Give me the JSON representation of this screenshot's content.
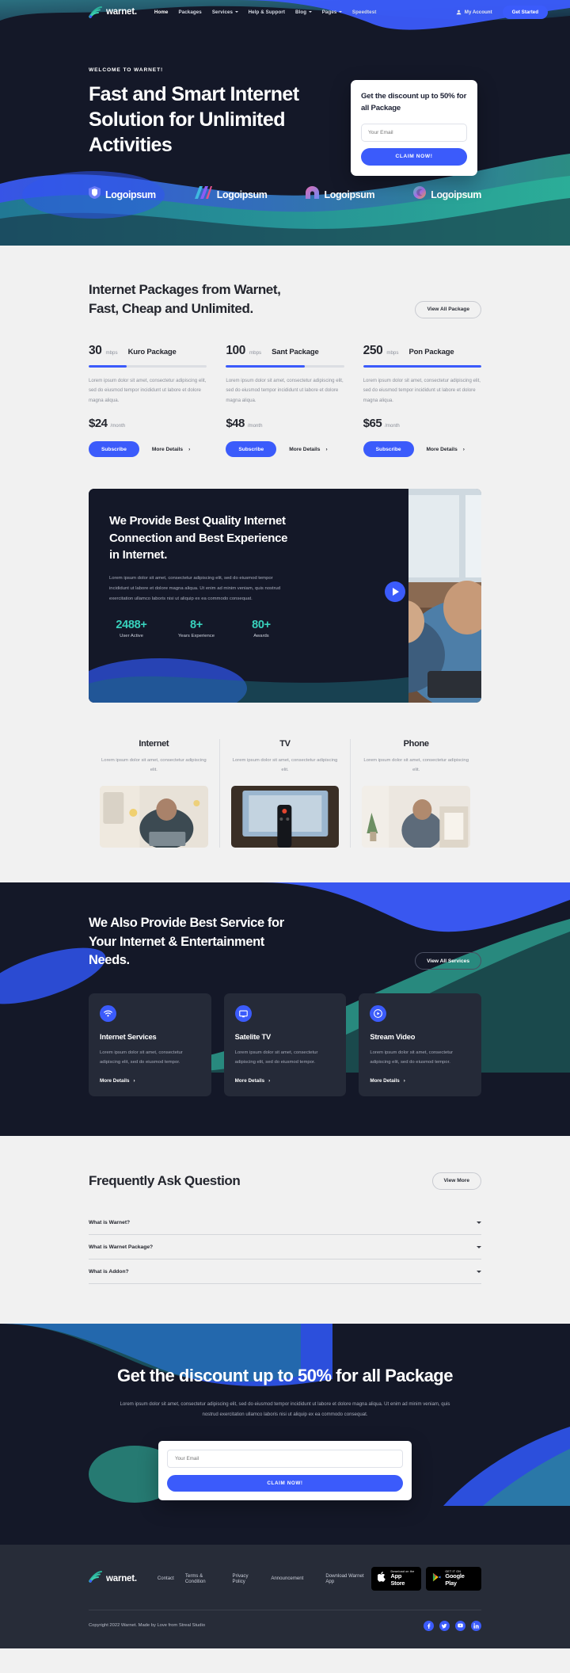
{
  "brand": {
    "name": "warnet.",
    "logo_icon": "wifi-wave-logo"
  },
  "nav": {
    "links": [
      {
        "label": "Home",
        "has_dropdown": false,
        "active": true
      },
      {
        "label": "Packages",
        "has_dropdown": false,
        "active": false
      },
      {
        "label": "Services",
        "has_dropdown": true,
        "active": false
      },
      {
        "label": "Help & Support",
        "has_dropdown": false,
        "active": false
      },
      {
        "label": "Blog",
        "has_dropdown": true,
        "active": false
      },
      {
        "label": "Pages",
        "has_dropdown": true,
        "active": false
      },
      {
        "label": "Speedtest",
        "has_dropdown": false,
        "active": false
      }
    ],
    "account_label": "My Account",
    "account_icon": "user-icon",
    "cta_label": "Get Started"
  },
  "hero": {
    "eyebrow": "WELCOME TO WARNET!",
    "title": "Fast and Smart Internet Solution for Unlimited Activities",
    "promo": {
      "title": "Get the discount up to 50% for all Package",
      "input_placeholder": "Your Email",
      "input_value": "",
      "button_label": "CLAIM NOW!"
    }
  },
  "logos": [
    {
      "label": "Logoipsum",
      "icon": "shield-logo"
    },
    {
      "label": "Logoipsum",
      "icon": "diagonal-bars-logo"
    },
    {
      "label": "Logoipsum",
      "icon": "arch-logo"
    },
    {
      "label": "Logoipsum",
      "icon": "swirl-logo"
    }
  ],
  "packages": {
    "title": "Internet Packages from Warnet, Fast, Cheap and Unlimited.",
    "view_all_label": "View All Package",
    "items": [
      {
        "speed": "30",
        "unit": "mbps",
        "name": "Kuro Package",
        "bar_percent": 32,
        "description": "Lorem ipsum dolor sit amet, consectetur adipiscing elit, sed do eiusmod tempor incididunt ut labore et dolore magna aliqua.",
        "price": "$24",
        "period": "/month",
        "subscribe_label": "Subscribe",
        "more_label": "More Details"
      },
      {
        "speed": "100",
        "unit": "mbps",
        "name": "Sant Package",
        "bar_percent": 67,
        "description": "Lorem ipsum dolor sit amet, consectetur adipiscing elit, sed do eiusmod tempor incididunt ut labore et dolore magna aliqua.",
        "price": "$48",
        "period": "/month",
        "subscribe_label": "Subscribe",
        "more_label": "More Details"
      },
      {
        "speed": "250",
        "unit": "mbps",
        "name": "Pon Package",
        "bar_percent": 100,
        "description": "Lorem ipsum dolor sit amet, consectetur adipiscing elit, sed do eiusmod tempor incididunt ut labore et dolore magna aliqua.",
        "price": "$65",
        "period": "/month",
        "subscribe_label": "Subscribe",
        "more_label": "More Details"
      }
    ]
  },
  "video_section": {
    "title": "We Provide Best Quality Internet Connection and Best Experience in Internet.",
    "description": "Lorem ipsum dolor sit amet, consectetur adipiscing elit, sed do eiusmod tempor incididunt ut labore et dolore magna aliqua. Ut enim ad minim veniam, quis nostrud exercitation ullamco laboris nisi ut aliquip ex ea commodo consequat.",
    "stats": [
      {
        "value": "2488+",
        "label": "User Active"
      },
      {
        "value": "8+",
        "label": "Years Experience"
      },
      {
        "value": "80+",
        "label": "Awards"
      }
    ],
    "play_icon": "play-icon"
  },
  "features": [
    {
      "title": "Internet",
      "description": "Lorem ipsum dolor sit amet, consectetur adipiscing elit.",
      "image_alt": "woman-on-laptop-photo"
    },
    {
      "title": "TV",
      "description": "Lorem ipsum dolor sit amet, consectetur adipiscing elit.",
      "image_alt": "tv-remote-photo"
    },
    {
      "title": "Phone",
      "description": "Lorem ipsum dolor sit amet, consectetur adipiscing elit.",
      "image_alt": "man-on-phone-photo"
    }
  ],
  "services": {
    "title": "We Also Provide Best Service for Your Internet & Entertainment Needs.",
    "view_all_label": "View All Services",
    "cards": [
      {
        "icon": "wifi-icon",
        "name": "Internet Services",
        "description": "Lorem ipsum dolor sit amet, consectetur adipiscing elit, sed do eiusmod tempor.",
        "more_label": "More Details"
      },
      {
        "icon": "monitor-icon",
        "name": "Satelite TV",
        "description": "Lorem ipsum dolor sit amet, consectetur adipiscing elit, sed do eiusmod tempor.",
        "more_label": "More Details"
      },
      {
        "icon": "play-circle-icon",
        "name": "Stream Video",
        "description": "Lorem ipsum dolor sit amet, consectetur adipiscing elit, sed do eiusmod tempor.",
        "more_label": "More Details"
      }
    ]
  },
  "faq": {
    "title": "Frequently Ask Question",
    "view_more_label": "View More",
    "items": [
      {
        "question": "What is Warnet?"
      },
      {
        "question": "What is Warnet Package?"
      },
      {
        "question": "What is Addon?"
      }
    ]
  },
  "cta": {
    "title": "Get the discount up to 50% for all Package",
    "description": "Lorem ipsum dolor sit amet, consectetur adipiscing elit, sed do eiusmod tempor incididunt ut labore et dolore magna aliqua. Ut enim ad minim veniam, quis nostrud exercitation ullamco laboris nisi ut aliquip ex ea commodo consequat.",
    "input_placeholder": "Your Email",
    "input_value": "",
    "button_label": "CLAIM NOW!"
  },
  "footer": {
    "brand_name": "warnet.",
    "links": [
      {
        "label": "Contact"
      },
      {
        "label": "Terms & Condition"
      },
      {
        "label": "Privacy Policy"
      },
      {
        "label": "Announcement"
      }
    ],
    "download_label": "Download Warnet App",
    "stores": [
      {
        "sub": "Download on the",
        "main": "App Store",
        "icon": "apple-icon"
      },
      {
        "sub": "GET IT ON",
        "main": "Google Play",
        "icon": "google-play-icon"
      }
    ],
    "copyright": "Copyright 2022 Warnet. Made by Love from Streal Studio",
    "socials": [
      {
        "icon": "facebook-icon",
        "glyph": "f"
      },
      {
        "icon": "twitter-icon",
        "glyph": "t"
      },
      {
        "icon": "youtube-icon",
        "glyph": "y"
      },
      {
        "icon": "linkedin-icon",
        "glyph": "in"
      }
    ]
  },
  "colors": {
    "accent": "#3b5bfb",
    "dark": "#141828",
    "teal": "#38d2bd",
    "light_bg": "#f1f1f1"
  }
}
